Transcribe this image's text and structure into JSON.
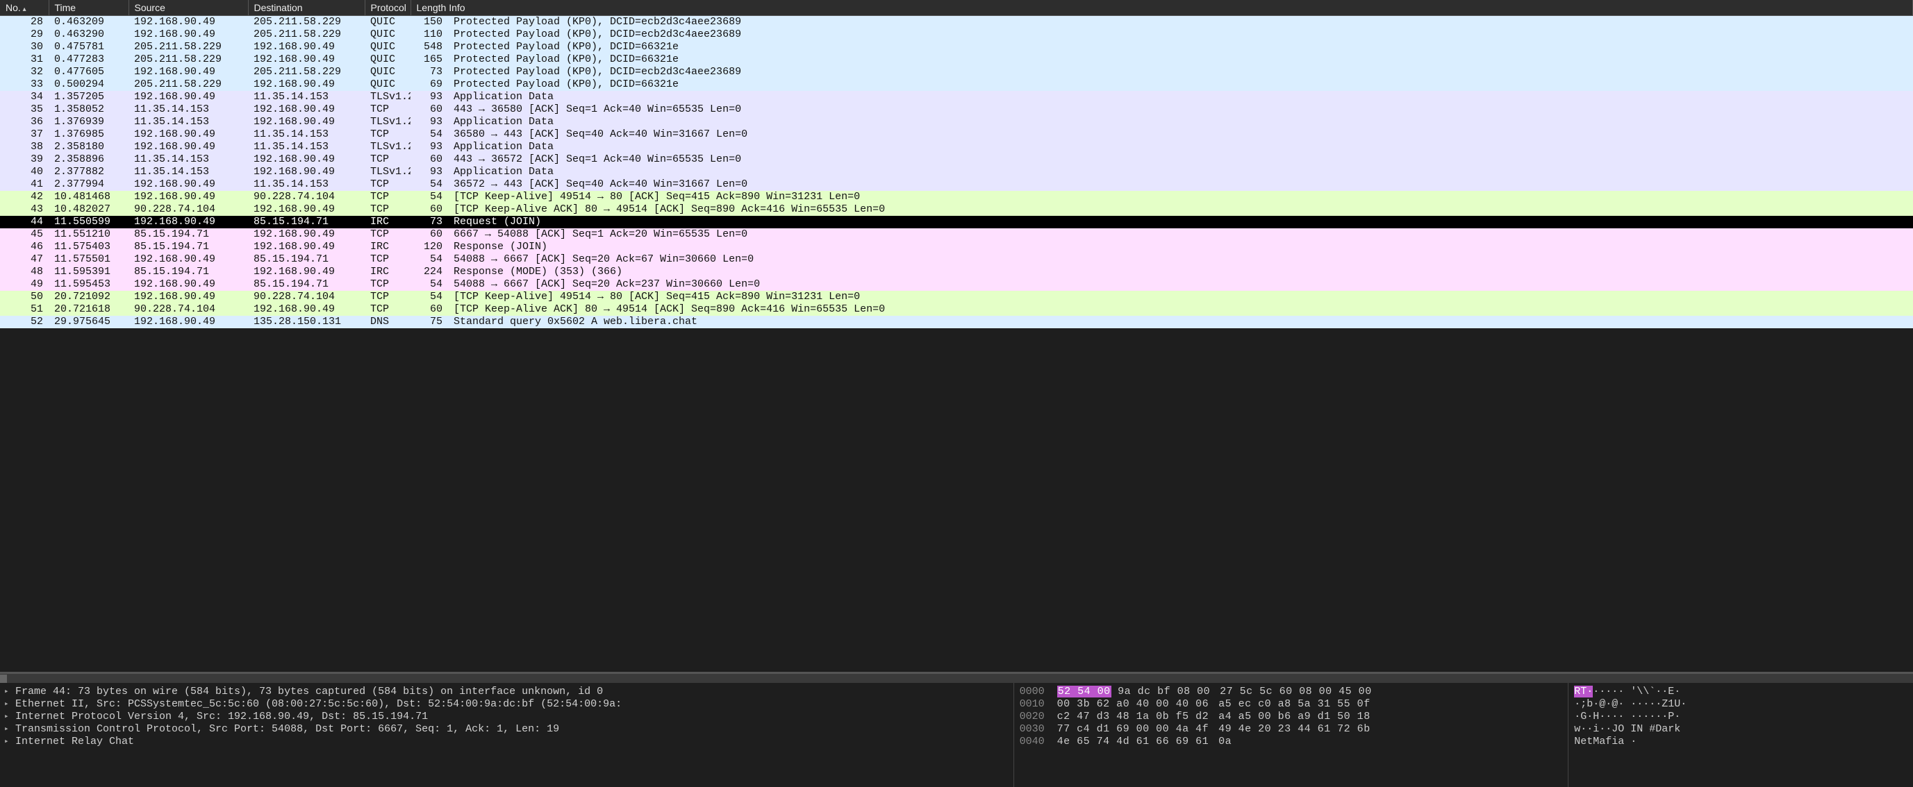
{
  "columns": {
    "no": "No.",
    "time": "Time",
    "source": "Source",
    "destination": "Destination",
    "protocol": "Protocol",
    "length": "Length",
    "info": "Info"
  },
  "packets": [
    {
      "no": "28",
      "time": "0.463209",
      "src": "192.168.90.49",
      "dst": "205.211.58.229",
      "proto": "QUIC",
      "len": "150",
      "info": "Protected Payload (KP0), DCID=ecb2d3c4aee23689",
      "cls": "quic"
    },
    {
      "no": "29",
      "time": "0.463290",
      "src": "192.168.90.49",
      "dst": "205.211.58.229",
      "proto": "QUIC",
      "len": "110",
      "info": "Protected Payload (KP0), DCID=ecb2d3c4aee23689",
      "cls": "quic"
    },
    {
      "no": "30",
      "time": "0.475781",
      "src": "205.211.58.229",
      "dst": "192.168.90.49",
      "proto": "QUIC",
      "len": "548",
      "info": "Protected Payload (KP0), DCID=66321e",
      "cls": "quic"
    },
    {
      "no": "31",
      "time": "0.477283",
      "src": "205.211.58.229",
      "dst": "192.168.90.49",
      "proto": "QUIC",
      "len": "165",
      "info": "Protected Payload (KP0), DCID=66321e",
      "cls": "quic"
    },
    {
      "no": "32",
      "time": "0.477605",
      "src": "192.168.90.49",
      "dst": "205.211.58.229",
      "proto": "QUIC",
      "len": "73",
      "info": "Protected Payload (KP0), DCID=ecb2d3c4aee23689",
      "cls": "quic"
    },
    {
      "no": "33",
      "time": "0.500294",
      "src": "205.211.58.229",
      "dst": "192.168.90.49",
      "proto": "QUIC",
      "len": "69",
      "info": "Protected Payload (KP0), DCID=66321e",
      "cls": "quic"
    },
    {
      "no": "34",
      "time": "1.357205",
      "src": "192.168.90.49",
      "dst": "11.35.14.153",
      "proto": "TLSv1.2",
      "len": "93",
      "info": "Application Data",
      "cls": "tlstcp"
    },
    {
      "no": "35",
      "time": "1.358052",
      "src": "11.35.14.153",
      "dst": "192.168.90.49",
      "proto": "TCP",
      "len": "60",
      "info": "443 → 36580 [ACK] Seq=1 Ack=40 Win=65535 Len=0",
      "cls": "tlstcp"
    },
    {
      "no": "36",
      "time": "1.376939",
      "src": "11.35.14.153",
      "dst": "192.168.90.49",
      "proto": "TLSv1.2",
      "len": "93",
      "info": "Application Data",
      "cls": "tlstcp"
    },
    {
      "no": "37",
      "time": "1.376985",
      "src": "192.168.90.49",
      "dst": "11.35.14.153",
      "proto": "TCP",
      "len": "54",
      "info": "36580 → 443 [ACK] Seq=40 Ack=40 Win=31667 Len=0",
      "cls": "tlstcp"
    },
    {
      "no": "38",
      "time": "2.358180",
      "src": "192.168.90.49",
      "dst": "11.35.14.153",
      "proto": "TLSv1.2",
      "len": "93",
      "info": "Application Data",
      "cls": "tlstcp"
    },
    {
      "no": "39",
      "time": "2.358896",
      "src": "11.35.14.153",
      "dst": "192.168.90.49",
      "proto": "TCP",
      "len": "60",
      "info": "443 → 36572 [ACK] Seq=1 Ack=40 Win=65535 Len=0",
      "cls": "tlstcp"
    },
    {
      "no": "40",
      "time": "2.377882",
      "src": "11.35.14.153",
      "dst": "192.168.90.49",
      "proto": "TLSv1.2",
      "len": "93",
      "info": "Application Data",
      "cls": "tlstcp"
    },
    {
      "no": "41",
      "time": "2.377994",
      "src": "192.168.90.49",
      "dst": "11.35.14.153",
      "proto": "TCP",
      "len": "54",
      "info": "36572 → 443 [ACK] Seq=40 Ack=40 Win=31667 Len=0",
      "cls": "tlstcp"
    },
    {
      "no": "42",
      "time": "10.481468",
      "src": "192.168.90.49",
      "dst": "90.228.74.104",
      "proto": "TCP",
      "len": "54",
      "info": "[TCP Keep-Alive] 49514 → 80 [ACK] Seq=415 Ack=890 Win=31231 Len=0",
      "cls": "keep"
    },
    {
      "no": "43",
      "time": "10.482027",
      "src": "90.228.74.104",
      "dst": "192.168.90.49",
      "proto": "TCP",
      "len": "60",
      "info": "[TCP Keep-Alive ACK] 80 → 49514 [ACK] Seq=890 Ack=416 Win=65535 Len=0",
      "cls": "keep"
    },
    {
      "no": "44",
      "time": "11.550599",
      "src": "192.168.90.49",
      "dst": "85.15.194.71",
      "proto": "IRC",
      "len": "73",
      "info": "Request (JOIN)",
      "cls": "selected"
    },
    {
      "no": "45",
      "time": "11.551210",
      "src": "85.15.194.71",
      "dst": "192.168.90.49",
      "proto": "TCP",
      "len": "60",
      "info": "6667 → 54088 [ACK] Seq=1 Ack=20 Win=65535 Len=0",
      "cls": "irc"
    },
    {
      "no": "46",
      "time": "11.575403",
      "src": "85.15.194.71",
      "dst": "192.168.90.49",
      "proto": "IRC",
      "len": "120",
      "info": "Response (JOIN)",
      "cls": "irc"
    },
    {
      "no": "47",
      "time": "11.575501",
      "src": "192.168.90.49",
      "dst": "85.15.194.71",
      "proto": "TCP",
      "len": "54",
      "info": "54088 → 6667 [ACK] Seq=20 Ack=67 Win=30660 Len=0",
      "cls": "irc"
    },
    {
      "no": "48",
      "time": "11.595391",
      "src": "85.15.194.71",
      "dst": "192.168.90.49",
      "proto": "IRC",
      "len": "224",
      "info": "Response (MODE) (353) (366)",
      "cls": "irc"
    },
    {
      "no": "49",
      "time": "11.595453",
      "src": "192.168.90.49",
      "dst": "85.15.194.71",
      "proto": "TCP",
      "len": "54",
      "info": "54088 → 6667 [ACK] Seq=20 Ack=237 Win=30660 Len=0",
      "cls": "irc"
    },
    {
      "no": "50",
      "time": "20.721092",
      "src": "192.168.90.49",
      "dst": "90.228.74.104",
      "proto": "TCP",
      "len": "54",
      "info": "[TCP Keep-Alive] 49514 → 80 [ACK] Seq=415 Ack=890 Win=31231 Len=0",
      "cls": "keep"
    },
    {
      "no": "51",
      "time": "20.721618",
      "src": "90.228.74.104",
      "dst": "192.168.90.49",
      "proto": "TCP",
      "len": "60",
      "info": "[TCP Keep-Alive ACK] 80 → 49514 [ACK] Seq=890 Ack=416 Win=65535 Len=0",
      "cls": "keep"
    },
    {
      "no": "52",
      "time": "29.975645",
      "src": "192.168.90.49",
      "dst": "135.28.150.131",
      "proto": "DNS",
      "len": "75",
      "info": "Standard query 0x5602 A web.libera.chat",
      "cls": "dns"
    }
  ],
  "tree": [
    "Frame 44: 73 bytes on wire (584 bits), 73 bytes captured (584 bits) on interface unknown, id 0",
    "Ethernet II, Src: PCSSystemtec_5c:5c:60 (08:00:27:5c:5c:60), Dst: 52:54:00:9a:dc:bf (52:54:00:9a:",
    "Internet Protocol Version 4, Src: 192.168.90.49, Dst: 85.15.194.71",
    "Transmission Control Protocol, Src Port: 54088, Dst Port: 6667, Seq: 1, Ack: 1, Len: 19",
    "Internet Relay Chat"
  ],
  "hex": [
    {
      "off": "0000",
      "b1_hl": "52 54 00",
      "b1": " 9a dc bf 08 00",
      "b2": "27 5c 5c 60 08 00 45 00"
    },
    {
      "off": "0010",
      "b1": "00 3b 62 a0 40 00 40 06",
      "b2": "a5 ec c0 a8 5a 31 55 0f"
    },
    {
      "off": "0020",
      "b1": "c2 47 d3 48 1a 0b f5 d2",
      "b2": "a4 a5 00 b6 a9 d1 50 18"
    },
    {
      "off": "0030",
      "b1": "77 c4 d1 69 00 00 4a 4f",
      "b2": "49 4e 20 23 44 61 72 6b"
    },
    {
      "off": "0040",
      "b1": "4e 65 74 4d 61 66 69 61",
      "b2": "0a"
    }
  ],
  "ascii": [
    {
      "hl": "RT·",
      "rest": "····· '\\\\`··E·"
    },
    {
      "rest": "·;b·@·@· ·····Z1U·"
    },
    {
      "rest": "·G·H···· ······P·"
    },
    {
      "rest": "w··i··JO IN #Dark"
    },
    {
      "rest": "NetMafia ·"
    }
  ]
}
